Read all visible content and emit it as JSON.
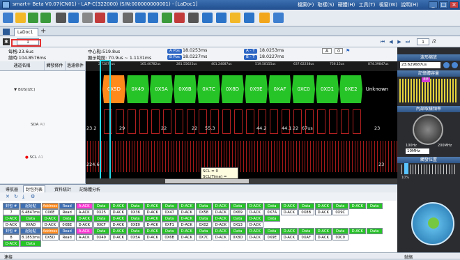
{
  "window": {
    "title": "smart+ Beta V0.07(CN01) - LAP-C(322000) (S/N:000000000001) - [LaDoc1]",
    "controls": [
      "_",
      "□",
      "×"
    ]
  },
  "menu": [
    "檔案(F)",
    "取樣(S)",
    "硬體(H)",
    "工具(T)",
    "視窗(W)",
    "說明(H)"
  ],
  "toolbar_icons": [
    "new-icon",
    "open-icon",
    "save-icon",
    "saveas-icon",
    "capture-icon",
    "settings-icon",
    "wrench-icon",
    "trigger-icon",
    "channel-icon",
    "bus-icon",
    "decode-icon",
    "export-icon",
    "search-icon",
    "filter-icon",
    "measure-icon",
    "zoomin-icon",
    "zoomout-icon",
    "report-icon",
    "info-icon",
    "star-icon",
    "screenshot-icon"
  ],
  "tab": {
    "doc": "LaDoc1",
    "add": "+"
  },
  "nav": {
    "page_value": "1",
    "page_current": "1",
    "page_total": "/2"
  },
  "info": {
    "sample_rate": "每格:23.6us",
    "total_time": "總時:104.8576ms",
    "center": "中心點:519.8us",
    "cursor_range": "顯示範圍: 70.9us ~ 1.1131ms",
    "a_pos_label": "A Pos",
    "a_pos_val": "18.0253ms",
    "b_pos_label": "B Pos",
    "b_pos_val": "18.0227ms",
    "a_t_label": "A - T",
    "a_t_val": "18.0253ms",
    "b_t_label": "B - T",
    "b_t_val": "18.0227ms",
    "trigger_sel": "A",
    "trigger_num": "0"
  },
  "ruler": {
    "ticks": [
      "2.72875us",
      "165.40782us",
      "281.55625us",
      "401.24087us",
      "519.58155us",
      "637.62238us",
      "756.15us",
      "874.39847us",
      "992.94687us"
    ]
  },
  "channels": {
    "headers": [
      "通道名稱",
      "觸發條件",
      "過濾條件"
    ],
    "rows": [
      {
        "name": "BUS(I2C)",
        "id": "I2C"
      },
      {
        "name": "SDA",
        "id": "A0"
      },
      {
        "name": "SCL",
        "id": "A1"
      }
    ]
  },
  "bus_packets": [
    {
      "label": "0X5D",
      "color": "#ff8a1c"
    },
    {
      "label": "0X49",
      "color": "#27c427"
    },
    {
      "label": "0X5A",
      "color": "#27c427"
    },
    {
      "label": "0X6B",
      "color": "#27c427"
    },
    {
      "label": "0X7C",
      "color": "#27c427"
    },
    {
      "label": "0X8D",
      "color": "#27c427"
    },
    {
      "label": "0X9E",
      "color": "#27c427"
    },
    {
      "label": "0XAF",
      "color": "#27c427"
    },
    {
      "label": "0XC0",
      "color": "#27c427"
    },
    {
      "label": "0XD1",
      "color": "#27c427"
    },
    {
      "label": "0XE2",
      "color": "#27c427"
    },
    {
      "label": "Unknown",
      "color": "#000000"
    }
  ],
  "sda_values": [
    "23.2",
    "29",
    "22",
    "22",
    "55.3",
    "44.2",
    "44.1",
    "22",
    "67us",
    "23"
  ],
  "scl_values": [
    "224.6",
    "23"
  ],
  "tooltip": {
    "line1": "SCL = 0",
    "line2": "SCL(Time) = 7.4us"
  },
  "right_panel": {
    "sections": [
      "波形縮放",
      "記憶體容量",
      "內部取樣頻率",
      "觸發位置"
    ],
    "zoom_value": "23.629687us",
    "memory_tag": "8M",
    "freq_min": "100Hz",
    "freq_max": "200MHz",
    "freq_value": "10MHz",
    "trigger_pos": "10%"
  },
  "bottom": {
    "tabs": [
      "導航器",
      "封包列表",
      "資料統計",
      "記憶體分析"
    ],
    "grid_rows": [
      [
        {
          "t": "封包 #",
          "c": "#3f6fb3",
          "fg": "#fff"
        },
        {
          "t": "起始點",
          "c": "#3f6fb3",
          "fg": "#fff"
        },
        {
          "t": "Address",
          "c": "#ff8a1c",
          "fg": "#fff"
        },
        {
          "t": "Read",
          "c": "#3f6fb3",
          "fg": "#fff"
        },
        {
          "t": "A-ACK",
          "c": "#ff35d4",
          "fg": "#fff"
        },
        {
          "t": "Data",
          "c": "#27c427",
          "fg": "#fff"
        },
        {
          "t": "D-ACK",
          "c": "#27c427",
          "fg": "#fff"
        },
        {
          "t": "Data",
          "c": "#27c427",
          "fg": "#fff"
        },
        {
          "t": "D-ACK",
          "c": "#27c427",
          "fg": "#fff"
        },
        {
          "t": "Data",
          "c": "#27c427",
          "fg": "#fff"
        },
        {
          "t": "D-ACK",
          "c": "#27c427",
          "fg": "#fff"
        },
        {
          "t": "Data",
          "c": "#27c427",
          "fg": "#fff"
        },
        {
          "t": "D-ACK",
          "c": "#27c427",
          "fg": "#fff"
        },
        {
          "t": "Data",
          "c": "#27c427",
          "fg": "#fff"
        },
        {
          "t": "D-ACK",
          "c": "#27c427",
          "fg": "#fff"
        },
        {
          "t": "Data",
          "c": "#27c427",
          "fg": "#fff"
        },
        {
          "t": "D-ACK",
          "c": "#27c427",
          "fg": "#fff"
        },
        {
          "t": "Data",
          "c": "#27c427",
          "fg": "#fff"
        },
        {
          "t": "D-ACK",
          "c": "#27c427",
          "fg": "#fff"
        },
        {
          "t": "Data",
          "c": "#27c427",
          "fg": "#fff"
        },
        {
          "t": "D-ACK",
          "c": "#27c427",
          "fg": "#fff"
        },
        {
          "t": "Data",
          "c": "#27c427",
          "fg": "#fff"
        }
      ],
      [
        {
          "t": "7"
        },
        {
          "t": "6.4847ms"
        },
        {
          "t": "0X6E"
        },
        {
          "t": "Read"
        },
        {
          "t": "A-ACK"
        },
        {
          "t": "0X25"
        },
        {
          "t": "D-ACK"
        },
        {
          "t": "0X36"
        },
        {
          "t": "D-ACK"
        },
        {
          "t": "0X47"
        },
        {
          "t": "D-ACK"
        },
        {
          "t": "0X58"
        },
        {
          "t": "D-ACK"
        },
        {
          "t": "0X69"
        },
        {
          "t": "D-ACK"
        },
        {
          "t": "0X7A"
        },
        {
          "t": "D-ACK"
        },
        {
          "t": "0X8B"
        },
        {
          "t": "D-ACK"
        },
        {
          "t": "0X9C"
        }
      ],
      [
        {
          "t": "D-ACK",
          "c": "#27c427",
          "fg": "#fff"
        },
        {
          "t": "Data",
          "c": "#27c427",
          "fg": "#fff"
        },
        {
          "t": "D-ACK",
          "c": "#27c427",
          "fg": "#fff"
        },
        {
          "t": "Data",
          "c": "#27c427",
          "fg": "#fff"
        },
        {
          "t": "D-ACK",
          "c": "#27c427",
          "fg": "#fff"
        },
        {
          "t": "Data",
          "c": "#27c427",
          "fg": "#fff"
        },
        {
          "t": "D-ACK",
          "c": "#27c427",
          "fg": "#fff"
        },
        {
          "t": "Data",
          "c": "#27c427",
          "fg": "#fff"
        },
        {
          "t": "D-ACK",
          "c": "#27c427",
          "fg": "#fff"
        },
        {
          "t": "Data",
          "c": "#27c427",
          "fg": "#fff"
        },
        {
          "t": "D-ACK",
          "c": "#27c427",
          "fg": "#fff"
        },
        {
          "t": "Data",
          "c": "#27c427",
          "fg": "#fff"
        },
        {
          "t": "D-ACK",
          "c": "#27c427",
          "fg": "#fff"
        },
        {
          "t": "Data",
          "c": "#27c427",
          "fg": "#fff"
        },
        {
          "t": "D-ACK",
          "c": "#27c427",
          "fg": "#fff"
        },
        {
          "t": "Data",
          "c": "#27c427",
          "fg": "#fff"
        }
      ],
      [
        {
          "t": "D-ACK"
        },
        {
          "t": "0XAD"
        },
        {
          "t": "D-ACK"
        },
        {
          "t": "0XBE"
        },
        {
          "t": "D-ACK"
        },
        {
          "t": "0XCF"
        },
        {
          "t": "D-ACK"
        },
        {
          "t": "0XE0"
        },
        {
          "t": "D-ACK"
        },
        {
          "t": "0XF1"
        },
        {
          "t": "D-ACK"
        },
        {
          "t": "0X02"
        },
        {
          "t": "D-ACK"
        },
        {
          "t": "0X13"
        },
        {
          "t": "D-ACK"
        }
      ],
      [
        {
          "t": "封包 #",
          "c": "#3f6fb3",
          "fg": "#fff"
        },
        {
          "t": "起始點",
          "c": "#3f6fb3",
          "fg": "#fff"
        },
        {
          "t": "Address",
          "c": "#ff8a1c",
          "fg": "#fff"
        },
        {
          "t": "Read",
          "c": "#3f6fb3",
          "fg": "#fff"
        },
        {
          "t": "A-ACK",
          "c": "#ff35d4",
          "fg": "#fff"
        },
        {
          "t": "Data",
          "c": "#27c427",
          "fg": "#fff"
        },
        {
          "t": "D-ACK",
          "c": "#27c427",
          "fg": "#fff"
        },
        {
          "t": "Data",
          "c": "#27c427",
          "fg": "#fff"
        },
        {
          "t": "D-ACK",
          "c": "#27c427",
          "fg": "#fff"
        },
        {
          "t": "Data",
          "c": "#27c427",
          "fg": "#fff"
        },
        {
          "t": "D-ACK",
          "c": "#27c427",
          "fg": "#fff"
        },
        {
          "t": "Data",
          "c": "#27c427",
          "fg": "#fff"
        },
        {
          "t": "D-ACK",
          "c": "#27c427",
          "fg": "#fff"
        },
        {
          "t": "Data",
          "c": "#27c427",
          "fg": "#fff"
        },
        {
          "t": "D-ACK",
          "c": "#27c427",
          "fg": "#fff"
        },
        {
          "t": "Data",
          "c": "#27c427",
          "fg": "#fff"
        },
        {
          "t": "D-ACK",
          "c": "#27c427",
          "fg": "#fff"
        },
        {
          "t": "Data",
          "c": "#27c427",
          "fg": "#fff"
        },
        {
          "t": "D-ACK",
          "c": "#27c427",
          "fg": "#fff"
        },
        {
          "t": "Data",
          "c": "#27c427",
          "fg": "#fff"
        },
        {
          "t": "D-ACK",
          "c": "#27c427",
          "fg": "#fff"
        },
        {
          "t": "Data",
          "c": "#27c427",
          "fg": "#fff"
        }
      ],
      [
        {
          "t": "8"
        },
        {
          "t": "8.1853ms"
        },
        {
          "t": "0X5D"
        },
        {
          "t": "Read"
        },
        {
          "t": "A-ACK"
        },
        {
          "t": "0X49"
        },
        {
          "t": "D-ACK"
        },
        {
          "t": "0X5A"
        },
        {
          "t": "D-ACK"
        },
        {
          "t": "0X6B"
        },
        {
          "t": "D-ACK"
        },
        {
          "t": "0X7C"
        },
        {
          "t": "D-ACK"
        },
        {
          "t": "0X8D"
        },
        {
          "t": "D-ACK"
        },
        {
          "t": "0X9E"
        },
        {
          "t": "D-ACK"
        },
        {
          "t": "0XAF"
        },
        {
          "t": "D-ACK"
        },
        {
          "t": "0XC0"
        }
      ],
      [
        {
          "t": "D-ACK",
          "c": "#27c427",
          "fg": "#fff"
        },
        {
          "t": "Data",
          "c": "#27c427",
          "fg": "#fff"
        }
      ]
    ]
  },
  "status": {
    "left": "連接",
    "right": "就緒"
  }
}
